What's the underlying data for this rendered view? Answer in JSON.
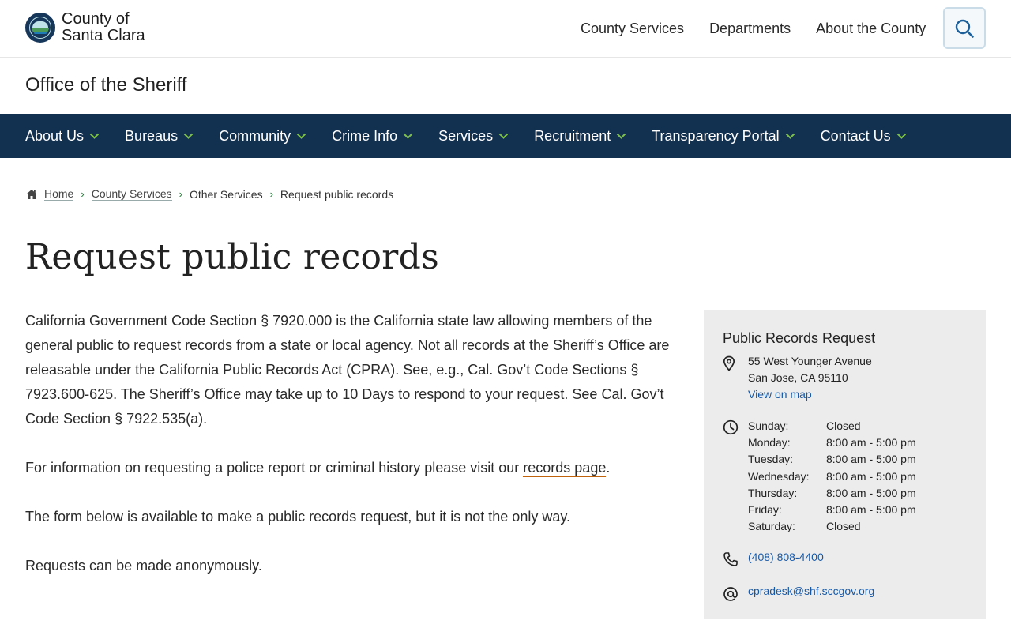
{
  "brand": {
    "logo_line1": "County of",
    "logo_line2": "Santa Clara",
    "logo_icon": "county-seal-icon"
  },
  "top_nav": {
    "items": [
      "County Services",
      "Departments",
      "About the County"
    ],
    "search_icon": "search-icon"
  },
  "office": {
    "name": "Office of the Sheriff"
  },
  "main_nav": {
    "items": [
      "About Us",
      "Bureaus",
      "Community",
      "Crime Info",
      "Services",
      "Recruitment",
      "Transparency Portal",
      "Contact Us"
    ],
    "chevron_color": "#7cc04b",
    "background": "#12304f"
  },
  "breadcrumb": {
    "home": "Home",
    "level1": "County Services",
    "level2": "Other Services",
    "current": "Request public records",
    "separator": "›"
  },
  "page": {
    "title": "Request public records",
    "paragraphs": {
      "p1": "California Government Code Section § 7920.000 is the California state law allowing members of the general public to request records from a state or local agency. Not all records at the Sheriff’s Office are releasable under the California Public Records Act (CPRA). See, e.g., Cal. Gov’t Code Sections § 7923.600-625. The Sheriff’s Office may take up to 10 Days to respond to your request. See Cal. Gov’t Code Section § 7922.535(a).",
      "p2_before": "For information on requesting a police report or criminal history please visit our ",
      "p2_link": "records page",
      "p2_after": ".",
      "p3": "The form below is available to make a public records request, but it is not the only way.",
      "p4": "Requests can be made anonymously."
    }
  },
  "sidebar": {
    "title": "Public Records Request",
    "address_line1": "55 West Younger Avenue",
    "address_line2": "San Jose, CA 95110",
    "map_link": "View on map",
    "hours": [
      {
        "day": "Sunday:",
        "time": "Closed"
      },
      {
        "day": "Monday:",
        "time": "8:00 am - 5:00 pm"
      },
      {
        "day": "Tuesday:",
        "time": "8:00 am - 5:00 pm"
      },
      {
        "day": "Wednesday:",
        "time": "8:00 am - 5:00 pm"
      },
      {
        "day": "Thursday:",
        "time": "8:00 am - 5:00 pm"
      },
      {
        "day": "Friday:",
        "time": "8:00 am - 5:00 pm"
      },
      {
        "day": "Saturday:",
        "time": "Closed"
      }
    ],
    "phone": "(408) 808-4400",
    "email": "cpradesk@shf.sccgov.org",
    "link_color": "#1659a8"
  }
}
